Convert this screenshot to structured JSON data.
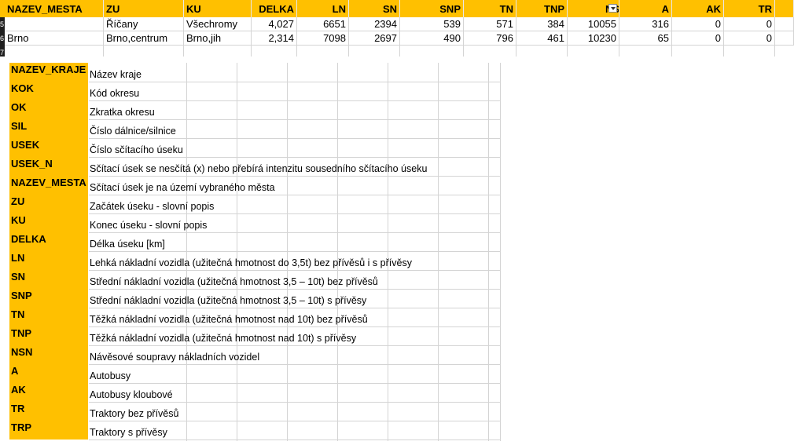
{
  "sheet": {
    "headers": [
      "NAZEV_MESTA",
      "ZU",
      "KU",
      "DELKA",
      "LN",
      "SN",
      "SNP",
      "TN",
      "TNP",
      "NSN",
      "A",
      "AK",
      "TR"
    ],
    "rows": [
      [
        "",
        "Říčany",
        "Všechromy",
        "4,027",
        "6651",
        "2394",
        "539",
        "571",
        "384",
        "10055",
        "316",
        "0",
        "0"
      ],
      [
        "Brno",
        "Brno,centrum",
        "Brno,jih",
        "2,314",
        "7098",
        "2697",
        "490",
        "796",
        "461",
        "10230",
        "65",
        "0",
        "0"
      ]
    ],
    "row_numbers": [
      "5",
      "6",
      "7"
    ],
    "header_fill": "#ffc000"
  },
  "legend": [
    {
      "code": "NAZEV_KRAJE",
      "desc": "Název kraje"
    },
    {
      "code": "KOK",
      "desc": "Kód okresu"
    },
    {
      "code": "OK",
      "desc": "Zkratka okresu"
    },
    {
      "code": "SIL",
      "desc": "Číslo dálnice/silnice"
    },
    {
      "code": "USEK",
      "desc": "Číslo sčítacího úseku"
    },
    {
      "code": "USEK_N",
      "desc": "Sčítací úsek se nesčítá (x) nebo přebírá intenzitu sousedního sčítacího úseku"
    },
    {
      "code": "NAZEV_MESTA",
      "desc": "Sčítací úsek je na území vybraného města"
    },
    {
      "code": "ZU",
      "desc": "Začátek úseku - slovní popis"
    },
    {
      "code": "KU",
      "desc": "Konec úseku - slovní popis"
    },
    {
      "code": "DELKA",
      "desc": "Délka úseku [km]"
    },
    {
      "code": "LN",
      "desc": "Lehká nákladní vozidla (užitečná hmotnost do 3,5t) bez přívěsů i s přívěsy"
    },
    {
      "code": "SN",
      "desc": "Střední nákladní vozidla (užitečná hmotnost 3,5 – 10t)  bez přívěsů"
    },
    {
      "code": "SNP",
      "desc": "Střední nákladní vozidla (užitečná hmotnost 3,5 – 10t)  s přívěsy"
    },
    {
      "code": "TN",
      "desc": "Těžká nákladní vozidla (užitečná hmotnost nad 10t) bez přívěsů"
    },
    {
      "code": "TNP",
      "desc": "Těžká nákladní vozidla (užitečná hmotnost nad 10t)  s přívěsy"
    },
    {
      "code": "NSN",
      "desc": "Návěsové soupravy nákladních vozidel"
    },
    {
      "code": "A",
      "desc": "Autobusy"
    },
    {
      "code": "AK",
      "desc": "Autobusy kloubové"
    },
    {
      "code": "TR",
      "desc": "Traktory bez přívěsů"
    },
    {
      "code": "TRP",
      "desc": "Traktory s přívěsy"
    }
  ]
}
